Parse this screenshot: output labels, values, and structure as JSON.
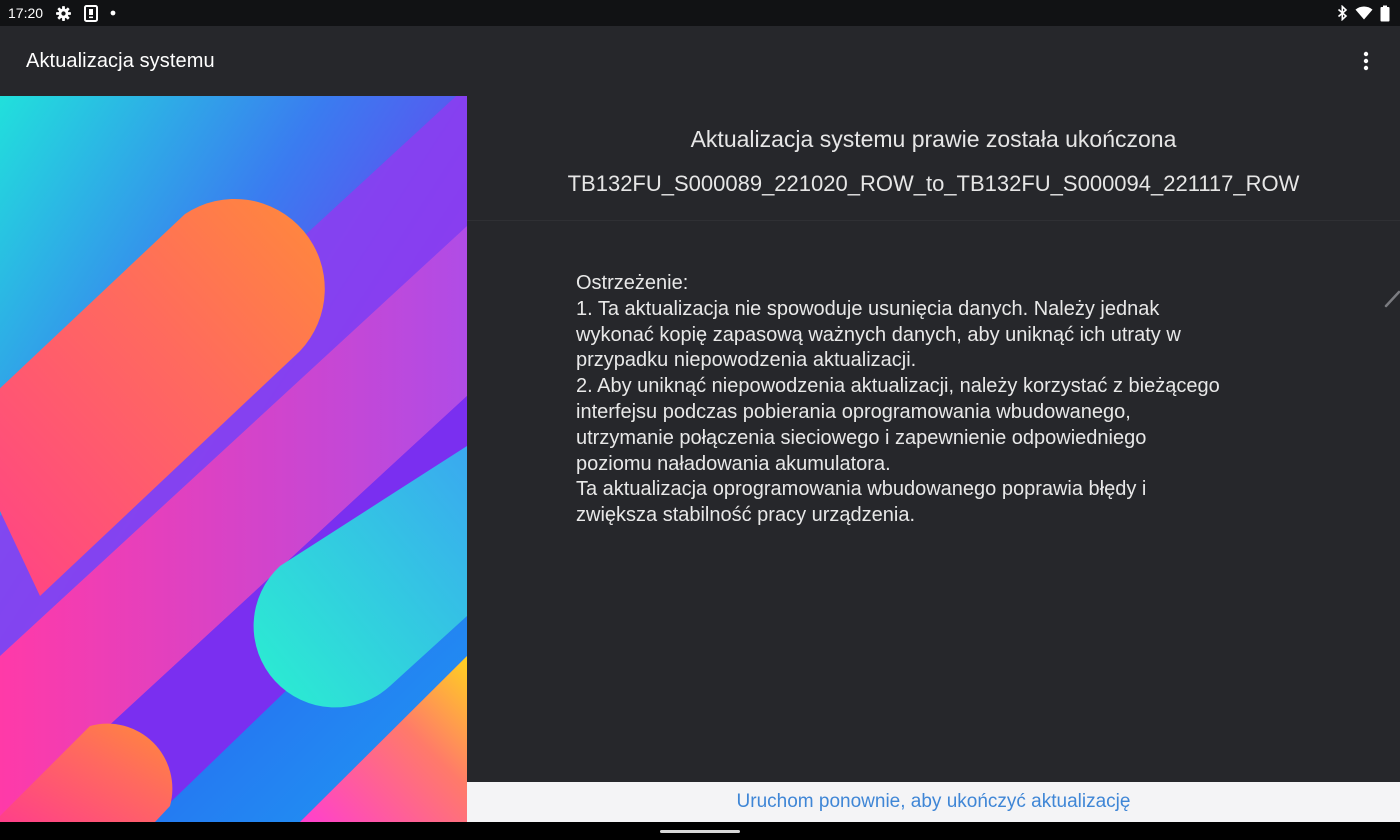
{
  "status_bar": {
    "time": "17:20",
    "icons_left": [
      "settings-icon",
      "screenshot-icon",
      "notification-dot-icon"
    ],
    "icons_right": [
      "bluetooth-icon",
      "wifi-icon",
      "battery-icon"
    ]
  },
  "app_bar": {
    "title": "Aktualizacja systemu",
    "overflow_icon": "more-vert-icon"
  },
  "update": {
    "title": "Aktualizacja systemu prawie została ukończona",
    "version": "TB132FU_S000089_221020_ROW_to_TB132FU_S000094_221117_ROW",
    "body_lines": [
      "Ostrzeżenie:",
      "1. Ta aktualizacja nie spowoduje usunięcia danych. Należy jednak",
      "wykonać kopię zapasową ważnych danych, aby uniknąć ich utraty w",
      "przypadku niepowodzenia aktualizacji.",
      "2. Aby uniknąć niepowodzenia aktualizacji, należy korzystać z bieżącego",
      "interfejsu podczas pobierania oprogramowania wbudowanego,",
      "utrzymanie połączenia sieciowego i zapewnienie odpowiedniego",
      "poziomu naładowania akumulatora.",
      "Ta aktualizacja oprogramowania wbudowanego poprawia błędy i",
      "zwiększa stabilność pracy urządzenia."
    ]
  },
  "actions": {
    "restart_label": "Uruchom ponownie, aby ukończyć aktualizację"
  },
  "colors": {
    "background": "#26272b",
    "status_bar": "#111214",
    "accent_link": "#3f86d6",
    "button_bar": "#f4f4f6"
  }
}
